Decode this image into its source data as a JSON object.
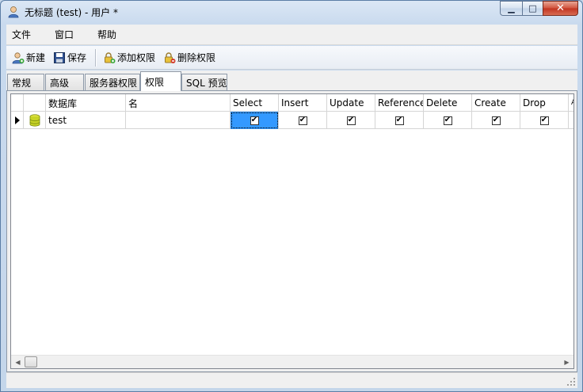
{
  "window": {
    "title": "无标题 (test) - 用户 *",
    "minimize_label": "▁",
    "maximize_label": "□",
    "close_label": "✕"
  },
  "menu": {
    "items": [
      "文件",
      "窗口",
      "帮助"
    ]
  },
  "toolbar": {
    "new_label": "新建",
    "save_label": "保存",
    "add_privilege_label": "添加权限",
    "delete_privilege_label": "删除权限"
  },
  "tabs": [
    {
      "label": "常规",
      "active": false
    },
    {
      "label": "高级",
      "active": false
    },
    {
      "label": "服务器权限",
      "active": false
    },
    {
      "label": "权限",
      "active": true
    },
    {
      "label": "SQL 预览",
      "active": false
    }
  ],
  "grid": {
    "columns": [
      "数据库",
      "名",
      "Select",
      "Insert",
      "Update",
      "References",
      "Delete",
      "Create",
      "Drop",
      "A"
    ],
    "rows": [
      {
        "database": "test",
        "name": "",
        "select": true,
        "insert": true,
        "update": true,
        "references": true,
        "delete": true,
        "create": true,
        "drop": true
      }
    ]
  },
  "icons": {
    "app": "user-icon",
    "row_indicator": "row-pointer-icon",
    "database": "database-icon"
  },
  "colors": {
    "selection": "#3399ff",
    "close_button": "#c13420"
  }
}
